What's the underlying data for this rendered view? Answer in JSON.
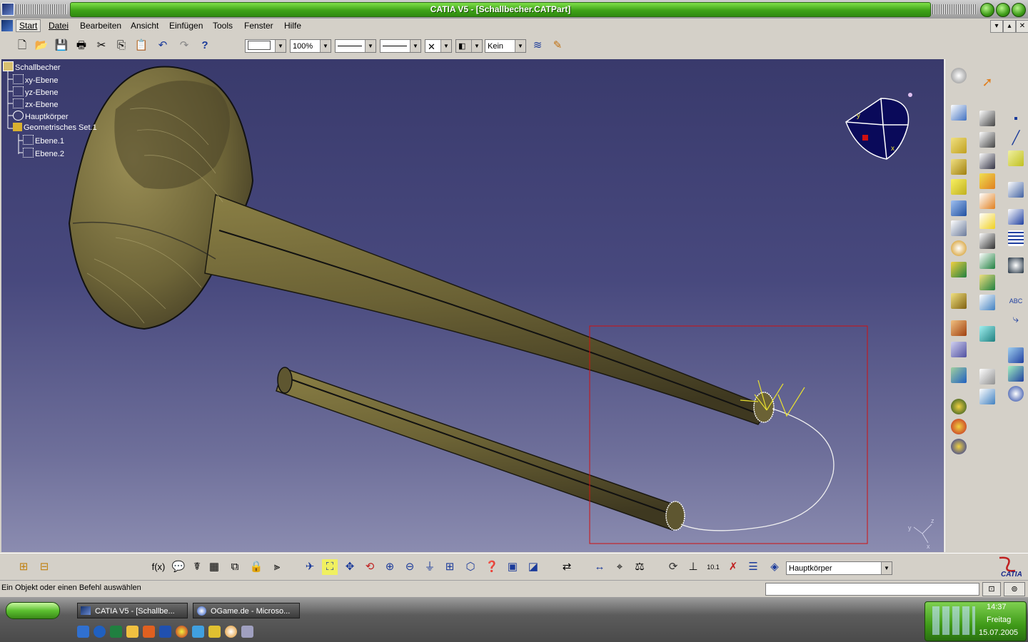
{
  "window": {
    "title": "CATIA V5 - [Schallbecher.CATPart]"
  },
  "menu": {
    "items": [
      "Start",
      "Datei",
      "Bearbeiten",
      "Ansicht",
      "Einfügen",
      "Tools",
      "Fenster",
      "Hilfe"
    ]
  },
  "toolbar_top": {
    "zoom": "100%",
    "layer": "Kein"
  },
  "tree": {
    "root": "Schallbecher",
    "items": [
      "xy-Ebene",
      "yz-Ebene",
      "zx-Ebene",
      "Hauptkörper",
      "Geometrisches Set.1",
      "Ebene.1",
      "Ebene.2"
    ]
  },
  "toolbar_bottom": {
    "current_body": "Hauptkörper"
  },
  "statusbar": {
    "prompt": "Ein Objekt oder einen Befehl auswählen"
  },
  "taskbar": {
    "tasks": [
      "CATIA V5 - [Schallbe...",
      "OGame.de - Microso..."
    ],
    "clock_time": "14:37",
    "clock_day": "Freitag",
    "clock_date": "15.07.2005"
  },
  "compass_axes": {
    "x": "x",
    "y": "y",
    "z": "z"
  },
  "colors": {
    "titlebar_green": "#3fa318",
    "viewport_top": "#393a6c",
    "viewport_bottom": "#8b8cb0",
    "part_color": "#6b6235",
    "selection_box": "#d01010"
  }
}
